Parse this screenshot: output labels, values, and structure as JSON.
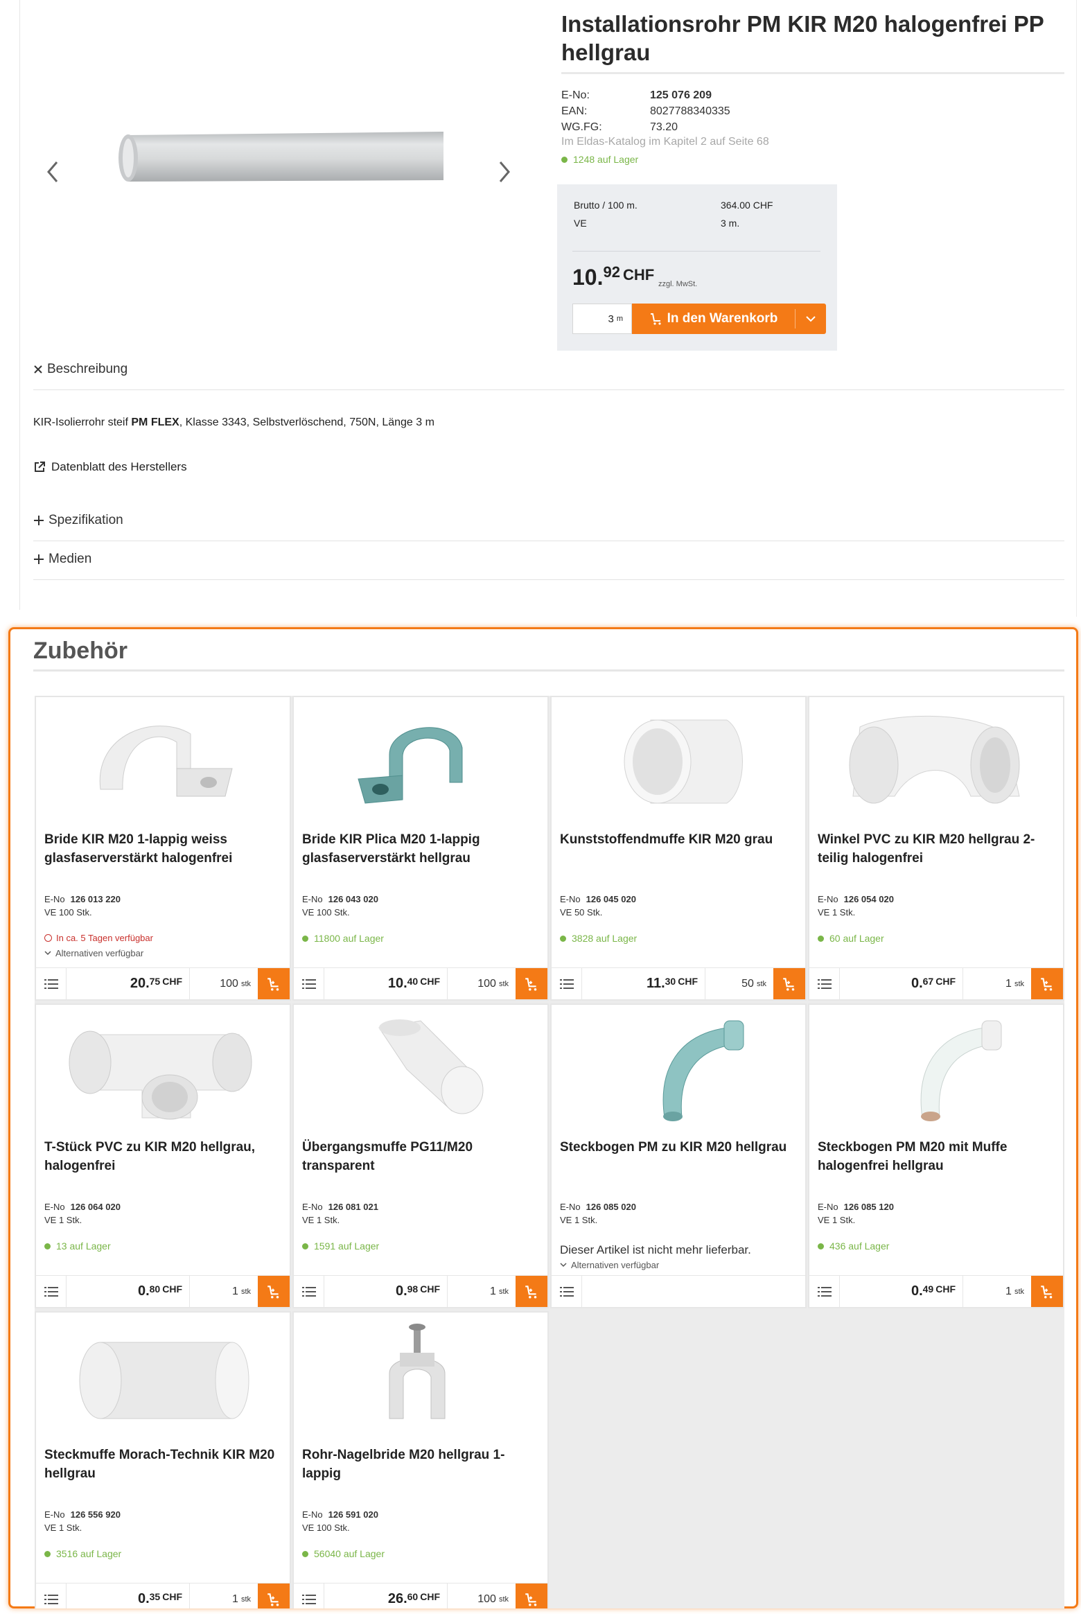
{
  "product": {
    "title": "Installationsrohr PM KIR M20 halogenfrei PP hellgrau",
    "meta": [
      {
        "label": "E-No:",
        "value": "125 076 209"
      },
      {
        "label": "EAN:",
        "value": "8027788340335"
      },
      {
        "label": "WG.FG:",
        "value": "73.20"
      }
    ],
    "catalog": "Im Eldas-Katalog im Kapitel 2 auf Seite 68",
    "stock": "1248 auf Lager",
    "brutto_label": "Brutto / 100 m.",
    "brutto_value": "364.00 CHF",
    "ve_label": "VE",
    "ve_value": "3 m.",
    "price_int": "10.",
    "price_dec": "92",
    "price_cur": "CHF",
    "mwst": "zzgl. MwSt.",
    "qty": "3",
    "qty_unit": "m",
    "cart_label": "In den Warenkorb"
  },
  "description": {
    "heading": "Beschreibung",
    "text_before": "KIR-Isolierrohr steif ",
    "text_bold": "PM FLEX",
    "text_after": ", Klasse 3343, Selbstverlöschend, 750N, Länge 3 m",
    "datasheet": "Datenblatt des Herstellers",
    "spec": "Spezifikation",
    "media": "Medien"
  },
  "accessories": {
    "title": "Zubehör",
    "eno_label": "E-No",
    "items": [
      {
        "name": "Bride KIR M20 1-lappig weiss glasfaserverstärkt halogenfrei",
        "eno": "126 013 220",
        "ve": "VE 100 Stk.",
        "status": "unavailable",
        "stock": "In ca. 5 Tagen verfügbar",
        "alt": "Alternativen verfügbar",
        "price_int": "20.",
        "price_dec": "75",
        "cur": "CHF",
        "qty": "100",
        "unit": "stk",
        "img": "clip-white"
      },
      {
        "name": "Bride KIR Plica M20 1-lappig glasfaserverstärkt hellgrau",
        "eno": "126 043 020",
        "ve": "VE 100 Stk.",
        "status": "instock",
        "stock": "11800 auf Lager",
        "price_int": "10.",
        "price_dec": "40",
        "cur": "CHF",
        "qty": "100",
        "unit": "stk",
        "img": "clip-teal"
      },
      {
        "name": "Kunststoffendmuffe KIR M20 grau",
        "eno": "126 045 020",
        "ve": "VE 50 Stk.",
        "status": "instock",
        "stock": "3828 auf Lager",
        "price_int": "11.",
        "price_dec": "30",
        "cur": "CHF",
        "qty": "50",
        "unit": "stk",
        "img": "sleeve"
      },
      {
        "name": "Winkel PVC zu KIR M20 hellgrau 2-teilig halogenfrei",
        "eno": "126 054 020",
        "ve": "VE 1 Stk.",
        "status": "instock",
        "stock": "60 auf Lager",
        "price_int": "0.",
        "price_dec": "67",
        "cur": "CHF",
        "qty": "1",
        "unit": "stk",
        "img": "elbow"
      },
      {
        "name": "T-Stück PVC zu KIR M20 hellgrau, halogenfrei",
        "eno": "126 064 020",
        "ve": "VE 1 Stk.",
        "status": "instock",
        "stock": "13 auf Lager",
        "price_int": "0.",
        "price_dec": "80",
        "cur": "CHF",
        "qty": "1",
        "unit": "stk",
        "img": "tee"
      },
      {
        "name": "Übergangsmuffe PG11/M20 transparent",
        "eno": "126 081 021",
        "ve": "VE 1 Stk.",
        "status": "instock",
        "stock": "1591 auf Lager",
        "price_int": "0.",
        "price_dec": "98",
        "cur": "CHF",
        "qty": "1",
        "unit": "stk",
        "img": "transition"
      },
      {
        "name": "Steckbogen PM zu KIR M20 hellgrau",
        "eno": "126 085 020",
        "ve": "VE 1 Stk.",
        "status": "discontinued",
        "stock": "Dieser Artikel ist nicht mehr lieferbar.",
        "alt": "Alternativen verfügbar",
        "img": "bend-teal"
      },
      {
        "name": "Steckbogen PM M20 mit Muffe halogenfrei hellgrau",
        "eno": "126 085 120",
        "ve": "VE 1 Stk.",
        "status": "instock",
        "stock": "436 auf Lager",
        "price_int": "0.",
        "price_dec": "49",
        "cur": "CHF",
        "qty": "1",
        "unit": "stk",
        "img": "bend-white"
      },
      {
        "name": "Steckmuffe Morach-Technik KIR M20 hellgrau",
        "eno": "126 556 920",
        "ve": "VE 1 Stk.",
        "status": "instock",
        "stock": "3516 auf Lager",
        "price_int": "0.",
        "price_dec": "35",
        "cur": "CHF",
        "qty": "1",
        "unit": "stk",
        "img": "coupler"
      },
      {
        "name": "Rohr-Nagelbride M20 hellgrau 1-lappig",
        "eno": "126 591 020",
        "ve": "VE 100 Stk.",
        "status": "instock",
        "stock": "56040 auf Lager",
        "price_int": "26.",
        "price_dec": "60",
        "cur": "CHF",
        "qty": "100",
        "unit": "stk",
        "img": "nailclip"
      }
    ]
  },
  "colors": {
    "accent": "#f47a16",
    "stock": "#7ab648",
    "unavailable": "#c9302c",
    "pricebox": "#eceef1"
  }
}
